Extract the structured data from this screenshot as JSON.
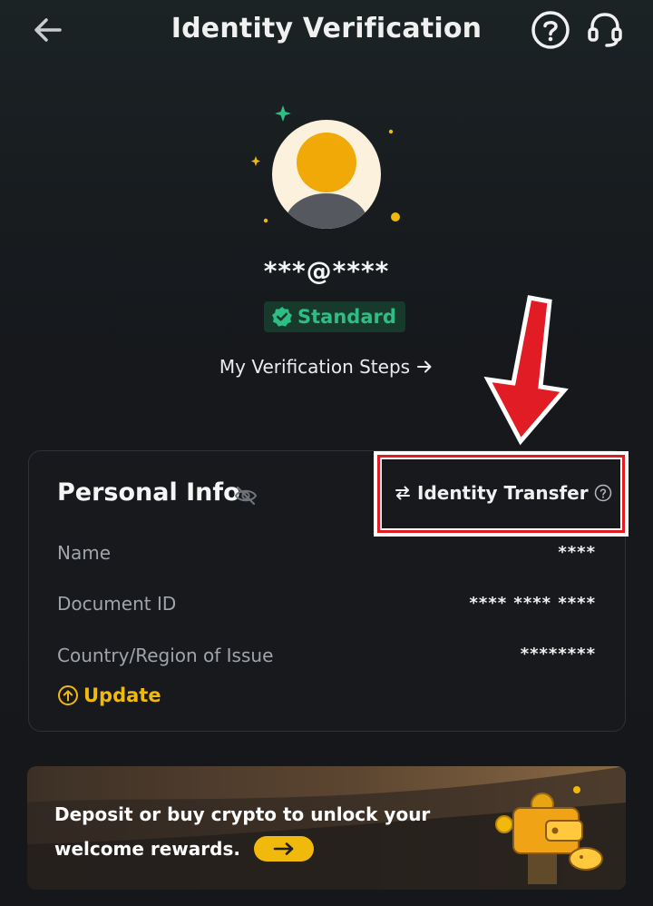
{
  "header": {
    "title": "Identity Verification",
    "icons": {
      "back": "arrow-left-icon",
      "help": "question-circle-icon",
      "support": "headset-icon"
    }
  },
  "profile": {
    "account": "***@****",
    "badge": {
      "label": "Standard",
      "icon": "verified-check-icon",
      "color": "#2ebd85"
    },
    "steps_link": "My Verification Steps",
    "steps_icon": "arrow-right-icon"
  },
  "personal_info": {
    "title": "Personal Info",
    "visibility_icon": "eye-off-icon",
    "identity_transfer": "Identity Transfer",
    "rows": [
      {
        "label": "Name",
        "value": "****"
      },
      {
        "label": "Document ID",
        "value": "**** **** ****"
      },
      {
        "label": "Country/Region of Issue",
        "value": "********"
      }
    ],
    "update_label": "Update"
  },
  "banner": {
    "line1": "Deposit or buy crypto to unlock your",
    "line2": "welcome rewards.",
    "cta_icon": "arrow-right-icon",
    "illustration": "wallet-coins-icon"
  },
  "colors": {
    "accent": "#f0b90b",
    "success": "#2ebd85",
    "annotation": "#e11c24"
  }
}
